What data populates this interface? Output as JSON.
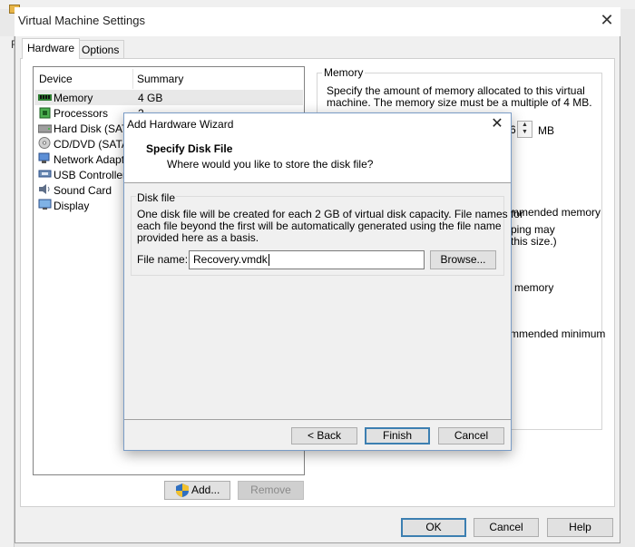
{
  "window": {
    "title": "Virtual Machine Settings",
    "tabs": [
      {
        "label": "Hardware"
      },
      {
        "label": "Options"
      }
    ]
  },
  "device_list": {
    "headers": {
      "device": "Device",
      "summary": "Summary"
    },
    "rows": [
      {
        "device": "Memory",
        "summary": "4 GB",
        "icon": "memory-icon"
      },
      {
        "device": "Processors",
        "summary": "2",
        "icon": "processor-icon"
      },
      {
        "device": "Hard Disk (SATA",
        "summary": "",
        "icon": "hard-disk-icon"
      },
      {
        "device": "CD/DVD (SATA)",
        "summary": "",
        "icon": "cd-dvd-icon"
      },
      {
        "device": "Network Adapte",
        "summary": "",
        "icon": "network-adapter-icon"
      },
      {
        "device": "USB Controller",
        "summary": "",
        "icon": "usb-icon"
      },
      {
        "device": "Sound Card",
        "summary": "",
        "icon": "sound-card-icon"
      },
      {
        "device": "Display",
        "summary": "",
        "icon": "display-icon"
      }
    ],
    "add_label": "Add...",
    "remove_label": "Remove"
  },
  "memory_panel": {
    "legend": "Memory",
    "description_line1": "Specify the amount of memory allocated to this virtual",
    "description_line2": "machine. The memory size must be a multiple of 4 MB.",
    "unit": "MB",
    "partial_spinner_value": "6",
    "partial_recommended": "mmended memory",
    "partial_swapping": "ping may",
    "partial_size": "this size.)",
    "partial_memory": "memory",
    "partial_minimum": "mmended minimum"
  },
  "wizard": {
    "title": "Add Hardware Wizard",
    "heading": "Specify Disk File",
    "subheading": "Where would you like to store the disk file?",
    "group_legend": "Disk file",
    "description_line1": "One disk file will be created for each 2 GB of virtual disk capacity. File names for",
    "description_line2": "each file beyond the first will be automatically generated using the file name",
    "description_line3": "provided here as a basis.",
    "file_name_label": "File name:",
    "file_name_value": "Recovery.vmdk",
    "browse_label": "Browse...",
    "back_label": "< Back",
    "finish_label": "Finish",
    "cancel_label": "Cancel"
  },
  "footer": {
    "ok_label": "OK",
    "cancel_label": "Cancel",
    "help_label": "Help"
  },
  "background": {
    "edge_letter": "F"
  }
}
